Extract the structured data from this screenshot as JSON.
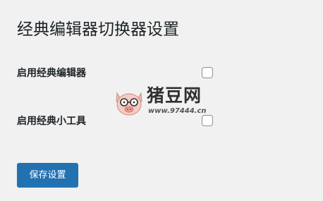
{
  "page": {
    "title": "经典编辑器切换器设置"
  },
  "settings": {
    "options": [
      {
        "label": "启用经典编辑器",
        "checked": false
      },
      {
        "label": "启用经典小工具",
        "checked": false
      }
    ]
  },
  "actions": {
    "save_label": "保存设置"
  },
  "watermark": {
    "name": "猪豆网",
    "url": "www.97444.cn",
    "logo_icon": "pig-face-icon"
  },
  "colors": {
    "primary": "#2271b1",
    "background": "#f1f1f1",
    "text": "#1d2327"
  }
}
